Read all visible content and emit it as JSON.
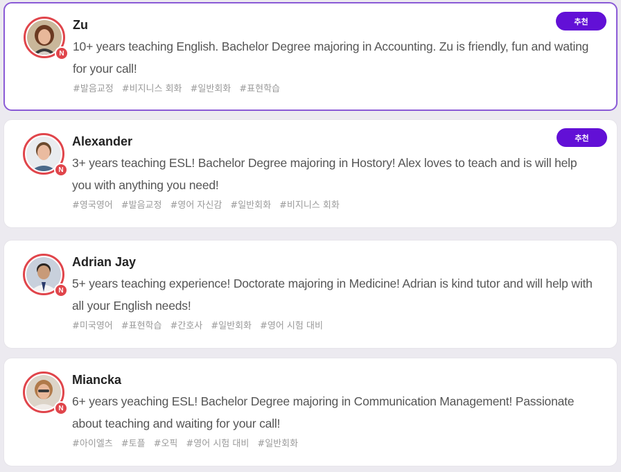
{
  "tutors": [
    {
      "name": "Zu",
      "bio": "10+ years teaching English. Bachelor Degree majoring in Accounting. Zu is friendly, fun and wating for your call!",
      "tags": [
        "#발음교정",
        "#비지니스 회화",
        "#일반회화",
        "#표현학습"
      ],
      "recommended_label": "추천",
      "new_badge": "N"
    },
    {
      "name": "Alexander",
      "bio": "3+ years teaching ESL! Bachelor Degree majoring in Hostory! Alex loves to teach and is will help you with anything you need!",
      "tags": [
        "#영국영어",
        "#발음교정",
        "#영어 자신감",
        "#일반회화",
        "#비지니스 회화"
      ],
      "recommended_label": "추천",
      "new_badge": "N"
    },
    {
      "name": "Adrian Jay",
      "bio": "5+ years teaching experience! Doctorate majoring in Medicine! Adrian is kind tutor and will help with all your English needs!",
      "tags": [
        "#미국영어",
        "#표현학습",
        "#간호사",
        "#일반회화",
        "#영어 시험 대비"
      ],
      "new_badge": "N"
    },
    {
      "name": "Miancka",
      "bio": "6+ years yeaching ESL! Bachelor Degree majoring in Communication Management! Passionate about teaching and waiting for your call!",
      "tags": [
        "#아이엘츠",
        "#토플",
        "#오픽",
        "#영어 시험 대비",
        "#일반회화"
      ],
      "new_badge": "N"
    }
  ],
  "colors": {
    "accent": "#6210d6",
    "badge": "#e0454b",
    "selected_border": "#8a5ad6"
  }
}
